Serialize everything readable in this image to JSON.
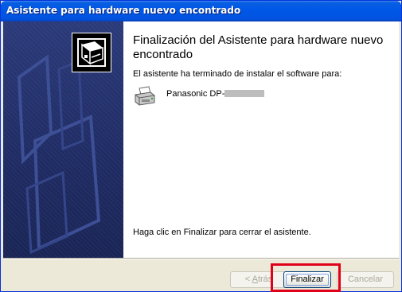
{
  "window": {
    "title": "Asistente para hardware nuevo encontrado"
  },
  "wizard": {
    "heading": "Finalización del Asistente para hardware nuevo encontrado",
    "intro": "El asistente ha terminado de instalar el software para:",
    "device_name": "Panasonic DP-",
    "finish_hint": "Haga clic en Finalizar para cerrar el asistente."
  },
  "buttons": {
    "back_prefix": "< ",
    "back_accel": "A",
    "back_rest": "trás",
    "finish": "Finalizar",
    "cancel": "Cancelar"
  },
  "states": {
    "back_enabled": false,
    "finish_enabled": true,
    "cancel_enabled": false
  },
  "icons": {
    "wizard": "hardware-wizard-icon",
    "device": "printer-icon"
  },
  "colors": {
    "titlebar": "#0058e6",
    "banner": "#1f2b63",
    "highlight": "#e0001a",
    "dialog_bg": "#ece9d8"
  }
}
